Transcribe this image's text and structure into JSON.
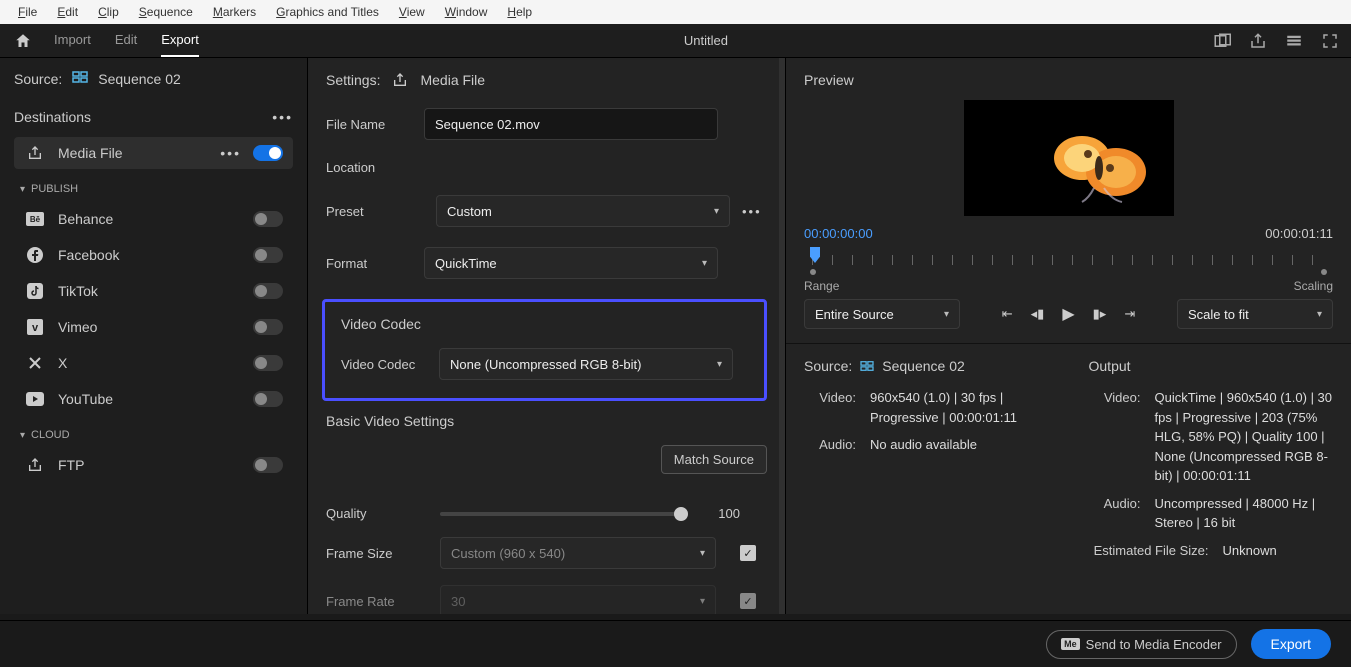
{
  "menubar": [
    "File",
    "Edit",
    "Clip",
    "Sequence",
    "Markers",
    "Graphics and Titles",
    "View",
    "Window",
    "Help"
  ],
  "appbar": {
    "tabs": [
      "Import",
      "Edit",
      "Export"
    ],
    "active_tab": 2,
    "title": "Untitled"
  },
  "left": {
    "source_label": "Source:",
    "source_name": "Sequence 02",
    "dest_header": "Destinations",
    "media_file": "Media File",
    "publish_label": "PUBLISH",
    "publish_items": [
      {
        "name": "Behance",
        "icon": "behance"
      },
      {
        "name": "Facebook",
        "icon": "facebook"
      },
      {
        "name": "TikTok",
        "icon": "tiktok"
      },
      {
        "name": "Vimeo",
        "icon": "vimeo"
      },
      {
        "name": "X",
        "icon": "x"
      },
      {
        "name": "YouTube",
        "icon": "youtube"
      }
    ],
    "cloud_label": "CLOUD",
    "ftp": "FTP"
  },
  "settings": {
    "header_label": "Settings:",
    "header_target": "Media File",
    "file_name_label": "File Name",
    "file_name_value": "Sequence 02.mov",
    "location_label": "Location",
    "preset_label": "Preset",
    "preset_value": "Custom",
    "format_label": "Format",
    "format_value": "QuickTime",
    "video_codec_section": "Video Codec",
    "video_codec_label": "Video Codec",
    "video_codec_value": "None (Uncompressed RGB 8-bit)",
    "basic_title": "Basic Video Settings",
    "match_source": "Match Source",
    "quality_label": "Quality",
    "quality_value": "100",
    "frame_size_label": "Frame Size",
    "frame_size_value": "Custom (960 x 540)",
    "frame_rate_label": "Frame Rate",
    "frame_rate_value": "30"
  },
  "preview": {
    "title": "Preview",
    "tc_start": "00:00:00:00",
    "tc_end": "00:00:01:11",
    "range_label": "Range",
    "scaling_label": "Scaling",
    "range_value": "Entire Source",
    "scaling_value": "Scale to fit",
    "source": {
      "label": "Source:",
      "name": "Sequence 02",
      "video_label": "Video:",
      "video_val": "960x540 (1.0) | 30 fps | Progressive | 00:00:01:11",
      "audio_label": "Audio:",
      "audio_val": "No audio available"
    },
    "output": {
      "label": "Output",
      "video_label": "Video:",
      "video_val": "QuickTime | 960x540 (1.0) | 30 fps | Progressive | 203 (75% HLG, 58% PQ) | Quality 100 | None (Uncompressed RGB 8-bit) | 00:00:01:11",
      "audio_label": "Audio:",
      "audio_val": "Uncompressed | 48000 Hz | Stereo | 16 bit",
      "est_label": "Estimated File Size:",
      "est_val": "Unknown"
    }
  },
  "footer": {
    "encoder": "Send to Media Encoder",
    "export": "Export"
  }
}
